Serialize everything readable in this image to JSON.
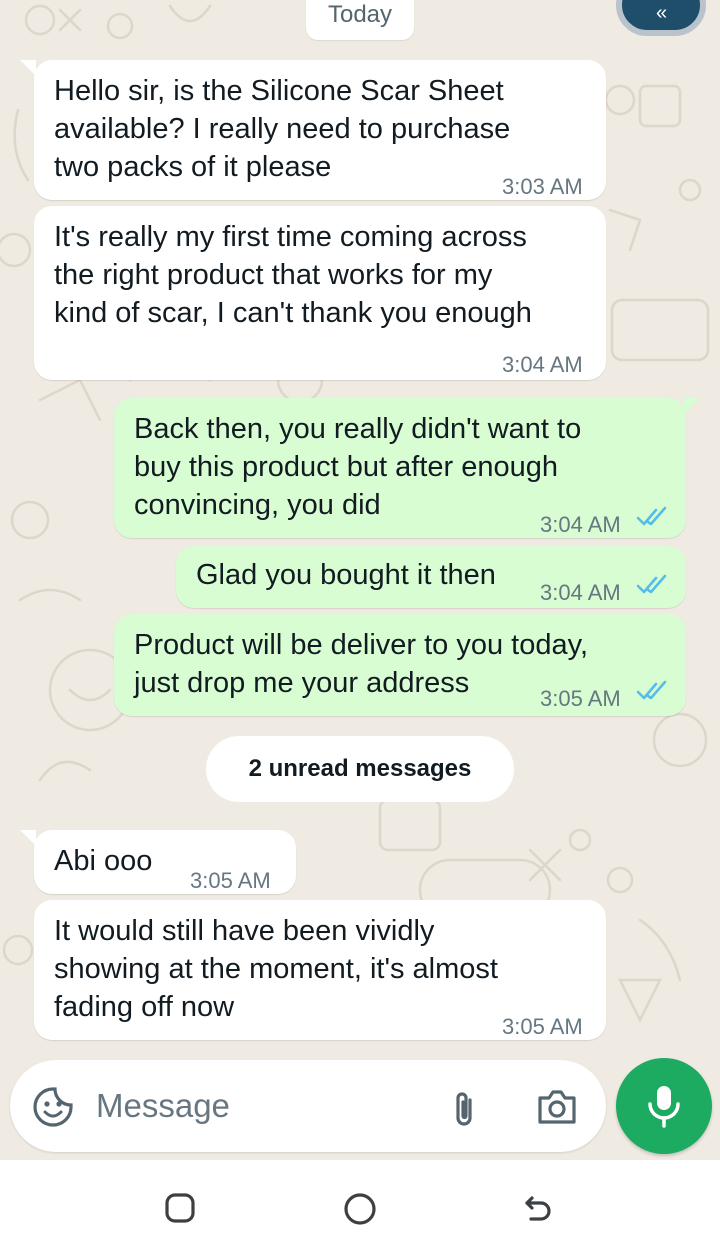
{
  "chat": {
    "date_chip": "Today",
    "messages": [
      {
        "direction": "in",
        "text": "Hello sir, is the Silicone Scar Sheet\navailable? I really need to purchase\ntwo packs of it please",
        "time": "3:03 AM"
      },
      {
        "direction": "in",
        "text": "It's really my first time coming across\nthe right product that works for my\nkind of scar, I can't thank you enough",
        "time": "3:04 AM"
      },
      {
        "direction": "out",
        "text": "Back then, you really didn't want to\nbuy this product but after enough\nconvincing, you did",
        "time": "3:04 AM",
        "status": "read"
      },
      {
        "direction": "out",
        "text": "Glad you bought it then",
        "time": "3:04 AM",
        "status": "read"
      },
      {
        "direction": "out",
        "text": "Product will be deliver to you today,\njust drop me your address",
        "time": "3:05 AM",
        "status": "read"
      },
      {
        "direction": "in",
        "text": "Abi ooo",
        "time": "3:05 AM"
      },
      {
        "direction": "in",
        "text": "It would still have been vividly\nshowing at the moment, it's almost\nfading off now",
        "time": "3:05 AM"
      }
    ],
    "unread_divider": "2 unread messages"
  },
  "composer": {
    "placeholder": "Message",
    "icons": [
      "sticker-icon",
      "attach-icon",
      "camera-icon",
      "mic-icon"
    ]
  },
  "navbar": {
    "icons": [
      "recents-icon",
      "home-icon",
      "back-icon"
    ]
  },
  "colors": {
    "background": "#efeae2",
    "incoming_bubble": "#ffffff",
    "outgoing_bubble": "#d9fdd3",
    "read_ticks": "#53bdeb",
    "mic_button": "#1daa61",
    "scroll_button": "#1f4e6b"
  }
}
